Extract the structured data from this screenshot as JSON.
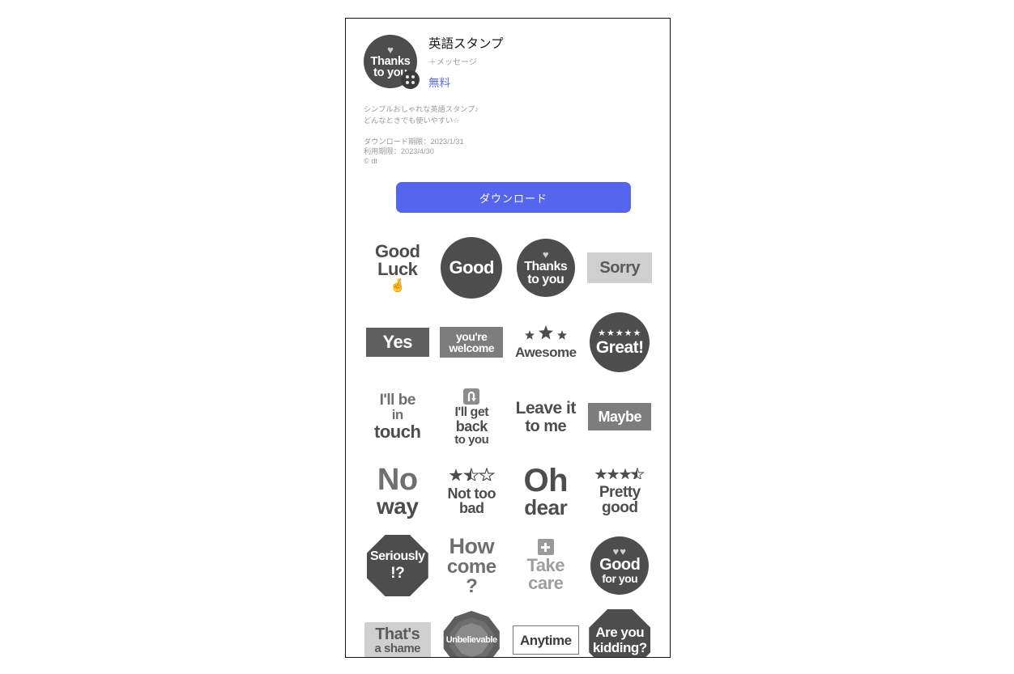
{
  "sticker_page": {
    "avatar": {
      "heart_icon": "heart-icon",
      "line1": "Thanks",
      "line2": "to you",
      "badge_icon": "message-badge-icon"
    },
    "title": "英語スタンプ",
    "subtitle": "＋メッセージ",
    "price": "無料",
    "description": [
      "シンプルおしゃれな英語スタンプ♪",
      "どんなときでも使いやすい☆"
    ],
    "meta": [
      "ダウンロード期限：2023/1/31",
      "利用期限：2023/4/30",
      "© dt"
    ],
    "download_button": "ダウンロード"
  },
  "colors": {
    "accent_blue": "#5566ee",
    "price_blue": "#5a6ae6",
    "dark_gray": "#4d4d4d",
    "mid_gray": "#6f6f6f",
    "light_gray": "#cfcfcf",
    "text_gray": "#9a9a9a"
  },
  "stickers": [
    {
      "id": "good-luck",
      "lines": [
        "Good",
        "Luck"
      ],
      "emoji": "🤞",
      "shape": "none"
    },
    {
      "id": "good",
      "lines": [
        "Good"
      ],
      "shape": "circle-dark"
    },
    {
      "id": "thanks-to-you",
      "lines": [
        "Thanks",
        "to you"
      ],
      "heart": "♥",
      "shape": "circle-dark"
    },
    {
      "id": "sorry",
      "lines": [
        "Sorry"
      ],
      "shape": "box-light"
    },
    {
      "id": "yes",
      "lines": [
        "Yes"
      ],
      "shape": "box-dark"
    },
    {
      "id": "youre-welcome",
      "lines": [
        "you're",
        "welcome"
      ],
      "shape": "box-mid"
    },
    {
      "id": "awesome",
      "lines": [
        "Awesome"
      ],
      "stars": "awesome-3star",
      "shape": "none"
    },
    {
      "id": "great",
      "lines": [
        "Great!"
      ],
      "stars": "★★★★★",
      "shape": "circle-dark"
    },
    {
      "id": "ill-be-in-touch",
      "lines": [
        "I'll be",
        "in",
        "touch"
      ],
      "shape": "none"
    },
    {
      "id": "ill-get-back",
      "lines": [
        "I'll get",
        "back",
        "to you"
      ],
      "icon": "uturn-arrow-icon",
      "shape": "none"
    },
    {
      "id": "leave-it-to-me",
      "lines": [
        "Leave it",
        "to me"
      ],
      "shape": "none"
    },
    {
      "id": "maybe",
      "lines": [
        "Maybe"
      ],
      "shape": "box-mid"
    },
    {
      "id": "no-way",
      "lines": [
        "No",
        "way"
      ],
      "shape": "none"
    },
    {
      "id": "not-too-bad",
      "lines": [
        "Not too",
        "bad"
      ],
      "stars": "★⯨☆",
      "shape": "none"
    },
    {
      "id": "oh-dear",
      "lines": [
        "Oh",
        "dear"
      ],
      "shape": "none"
    },
    {
      "id": "pretty-good",
      "lines": [
        "Pretty",
        "good"
      ],
      "stars": "★★★⯨",
      "shape": "none"
    },
    {
      "id": "seriously",
      "lines": [
        "Seriously",
        "!?"
      ],
      "shape": "octagon-dark"
    },
    {
      "id": "how-come",
      "lines": [
        "How",
        "come",
        "?"
      ],
      "shape": "none"
    },
    {
      "id": "take-care",
      "lines": [
        "Take",
        "care"
      ],
      "icon": "medical-cross-icon",
      "shape": "none"
    },
    {
      "id": "good-for-you",
      "lines": [
        "Good",
        "for you"
      ],
      "heart": "♥♥",
      "shape": "circle-dark"
    },
    {
      "id": "thats-a-shame",
      "lines": [
        "That's",
        "a shame"
      ],
      "shape": "box-light"
    },
    {
      "id": "unbelievable",
      "lines": [
        "Unbelievable"
      ],
      "shape": "decagon-layered"
    },
    {
      "id": "anytime",
      "lines": [
        "Anytime"
      ],
      "shape": "box-outline"
    },
    {
      "id": "are-you-kidding",
      "lines": [
        "Are you",
        "kidding?"
      ],
      "shape": "octagon-dark"
    }
  ]
}
